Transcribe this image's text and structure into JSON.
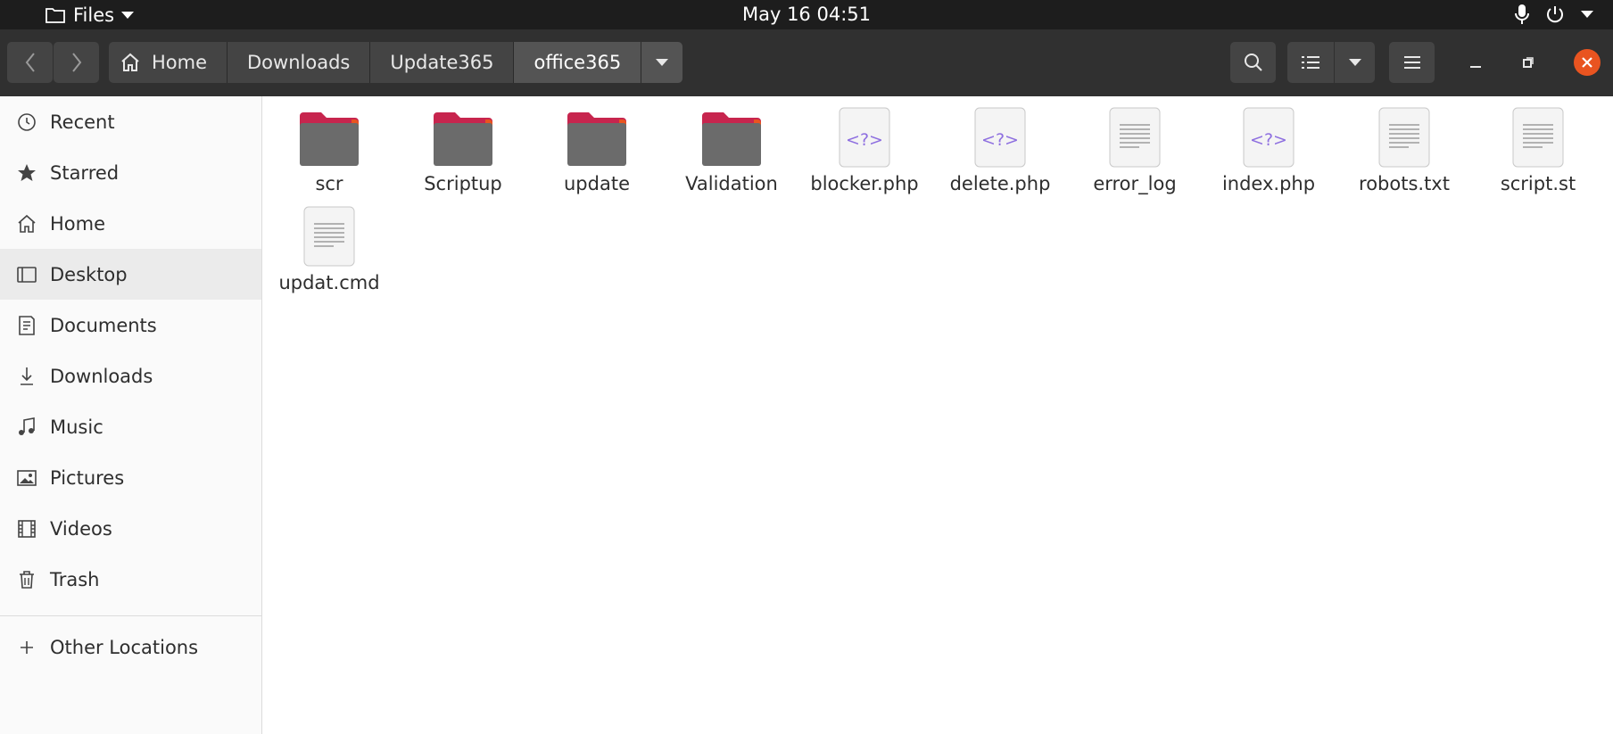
{
  "topbar": {
    "app_menu": "Files",
    "clock": "May 16  04:51"
  },
  "header": {
    "breadcrumbs": [
      "Home",
      "Downloads",
      "Update365",
      "office365"
    ]
  },
  "sidebar": {
    "items": [
      {
        "label": "Recent",
        "icon": "clock-icon"
      },
      {
        "label": "Starred",
        "icon": "star-icon"
      },
      {
        "label": "Home",
        "icon": "home-icon"
      },
      {
        "label": "Desktop",
        "icon": "desktop-icon",
        "active": true
      },
      {
        "label": "Documents",
        "icon": "document-icon"
      },
      {
        "label": "Downloads",
        "icon": "download-icon"
      },
      {
        "label": "Music",
        "icon": "music-icon"
      },
      {
        "label": "Pictures",
        "icon": "picture-icon"
      },
      {
        "label": "Videos",
        "icon": "video-icon"
      },
      {
        "label": "Trash",
        "icon": "trash-icon"
      }
    ],
    "other_locations": "Other Locations"
  },
  "files": [
    {
      "name": "scr",
      "type": "folder"
    },
    {
      "name": "Scriptup",
      "type": "folder"
    },
    {
      "name": "update",
      "type": "folder"
    },
    {
      "name": "Validation",
      "type": "folder"
    },
    {
      "name": "blocker.php",
      "type": "php"
    },
    {
      "name": "delete.php",
      "type": "php"
    },
    {
      "name": "error_log",
      "type": "text"
    },
    {
      "name": "index.php",
      "type": "php"
    },
    {
      "name": "robots.txt",
      "type": "text"
    },
    {
      "name": "script.st",
      "type": "text"
    },
    {
      "name": "updat.cmd",
      "type": "text"
    }
  ],
  "php_glyph": "<?>",
  "colors": {
    "accent_close": "#e95420",
    "folder_tab": "#c7254e",
    "folder_body": "#6b6b6b",
    "php_glyph": "#8e6fe0"
  }
}
